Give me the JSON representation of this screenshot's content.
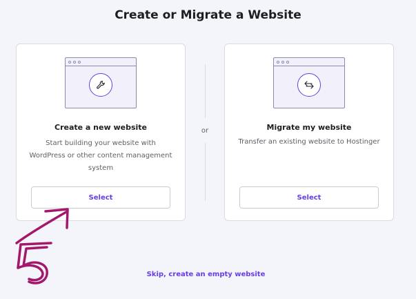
{
  "page": {
    "title": "Create or Migrate a Website"
  },
  "options": [
    {
      "title": "Create a new website",
      "description": "Start building your website with WordPress or other content management system",
      "button_label": "Select",
      "icon": "wrench-icon"
    },
    {
      "title": "Migrate my website",
      "description": "Transfer an existing website to Hostinger",
      "button_label": "Select",
      "icon": "arrows-swap-icon"
    }
  ],
  "divider": {
    "label": "or"
  },
  "footer": {
    "skip_label": "Skip, create an empty website"
  },
  "annotation": {
    "number": "5",
    "color": "#a3186a"
  },
  "colors": {
    "accent": "#673de6",
    "background": "#f4f4fb"
  }
}
